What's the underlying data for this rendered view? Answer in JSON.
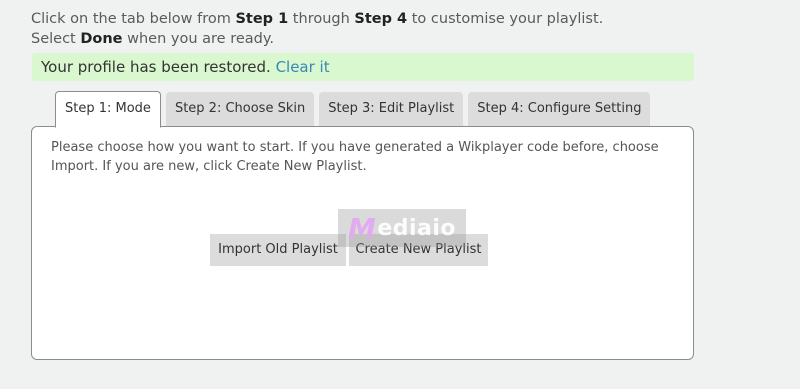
{
  "intro": {
    "p1": "Click on the tab below from ",
    "step_first": "Step 1",
    "p2": " through ",
    "step_last": "Step 4",
    "p3": " to customise your playlist.",
    "p4": "Select ",
    "done": "Done",
    "p5": " when you are ready."
  },
  "notice": {
    "message": "Your profile has been restored.",
    "link": "Clear it",
    "color": "#d9f8cf"
  },
  "tabs": [
    {
      "label": "Step 1: Mode",
      "active": true
    },
    {
      "label": "Step 2: Choose Skin",
      "active": false
    },
    {
      "label": "Step 3: Edit Playlist",
      "active": false
    },
    {
      "label": "Step 4: Configure Setting",
      "active": false
    }
  ],
  "panel": {
    "instructions": "Please choose how you want to start. If you have generated a Wikplayer code before, choose Import. If you are new, click Create New Playlist.",
    "import_button": "Import Old Playlist",
    "create_button": "Create New Playlist"
  },
  "watermark": {
    "initial": "M",
    "rest": "ediaio"
  }
}
